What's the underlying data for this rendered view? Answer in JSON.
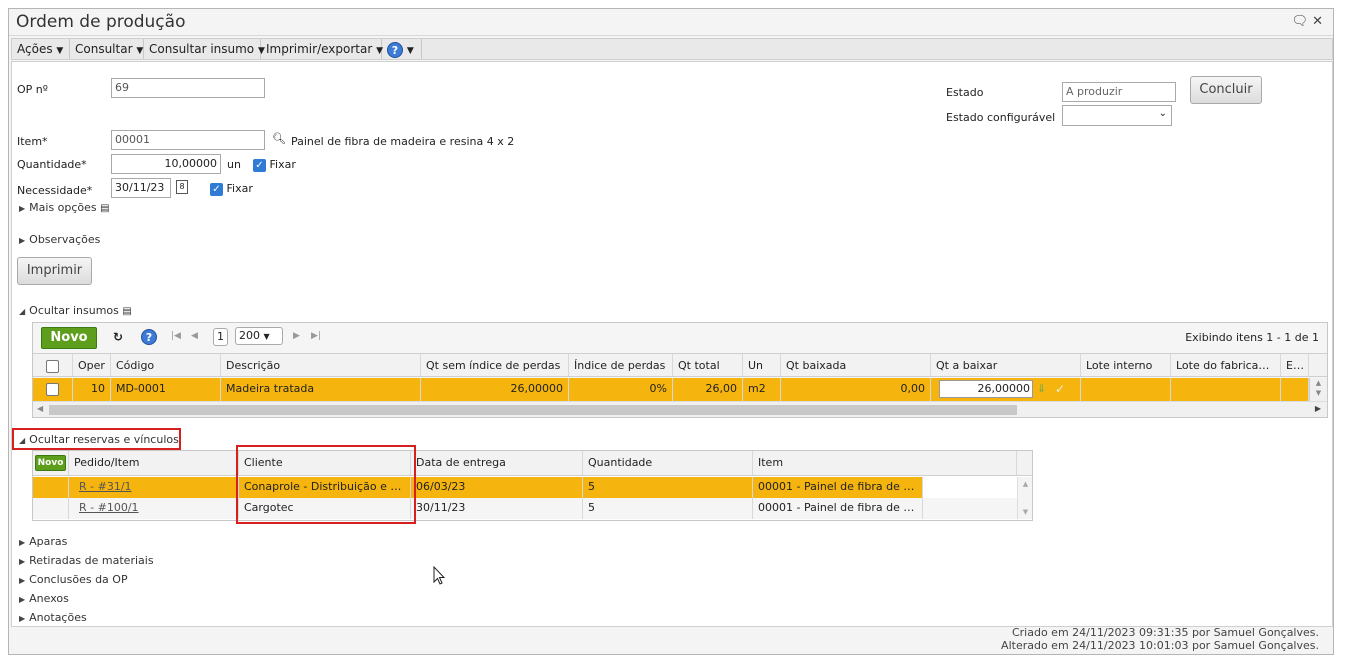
{
  "window": {
    "title": "Ordem de produção"
  },
  "menubar": {
    "acoes": "Ações",
    "consultar": "Consultar",
    "consultar_insumo": "Consultar insumo",
    "imprimir": "Imprimir/exportar"
  },
  "form": {
    "op_label": "OP nº",
    "op_value": "69",
    "item_label": "Item*",
    "item_value": "00001",
    "item_desc": "Painel de fibra de madeira e resina 4 x 2",
    "quantidade_label": "Quantidade*",
    "quantidade_value": "10,00000",
    "unit": "un",
    "fixar": "Fixar",
    "necessidade_label": "Necessidade*",
    "necessidade_value": "30/11/23",
    "estado_label": "Estado",
    "estado_value": "A produzir",
    "estado_config_label": "Estado configurável",
    "concluir": "Concluir",
    "mais_opcoes": "Mais opções",
    "observacoes": "Observações",
    "imprimir": "Imprimir",
    "ocultar_insumos": "Ocultar insumos"
  },
  "insumos": {
    "novo": "Novo",
    "page": "1",
    "per_page": "200",
    "exibindo": "Exibindo itens 1 - 1 de 1",
    "columns": [
      "Oper",
      "Código",
      "Descrição",
      "Qt sem índice de perdas",
      "Índice de perdas",
      "Qt total",
      "Un",
      "Qt baixada",
      "Qt a baixar",
      "Lote interno",
      "Lote do fabricante",
      "End"
    ],
    "rows": [
      {
        "oper": "10",
        "codigo": "MD-0001",
        "descricao": "Madeira tratada",
        "qt_sem": "26,00000",
        "indice": "0%",
        "qt_total": "26,00",
        "un": "m2",
        "qt_baixada": "0,00",
        "qt_a_baixar": "26,00000"
      }
    ]
  },
  "reservas": {
    "toggle": "Ocultar reservas e vínculos",
    "novo": "Novo",
    "columns": [
      "Pedido/Item",
      "Cliente",
      "Data de entrega",
      "Quantidade",
      "Item"
    ],
    "rows": [
      {
        "pedido": "R - #31/1",
        "cliente": "Conaprole - Distribuição e …",
        "data": "06/03/23",
        "quantidade": "5",
        "item": "00001 - Painel de fibra de …"
      },
      {
        "pedido": "R - #100/1",
        "cliente": "Cargotec",
        "data": "30/11/23",
        "quantidade": "5",
        "item": "00001 - Painel de fibra de …"
      }
    ]
  },
  "sections": [
    "Aparas",
    "Retiradas de materiais",
    "Conclusões da OP",
    "Anexos",
    "Anotações"
  ],
  "footer": {
    "criado": "Criado em 24/11/2023 09:31:35 por Samuel Gonçalves.",
    "alterado": "Alterado em 24/11/2023 10:01:03 por Samuel Gonçalves."
  },
  "colors": {
    "selected_row": "#f6b50e",
    "highlight": "#d62020",
    "novo_green": "#5d9f1d"
  }
}
